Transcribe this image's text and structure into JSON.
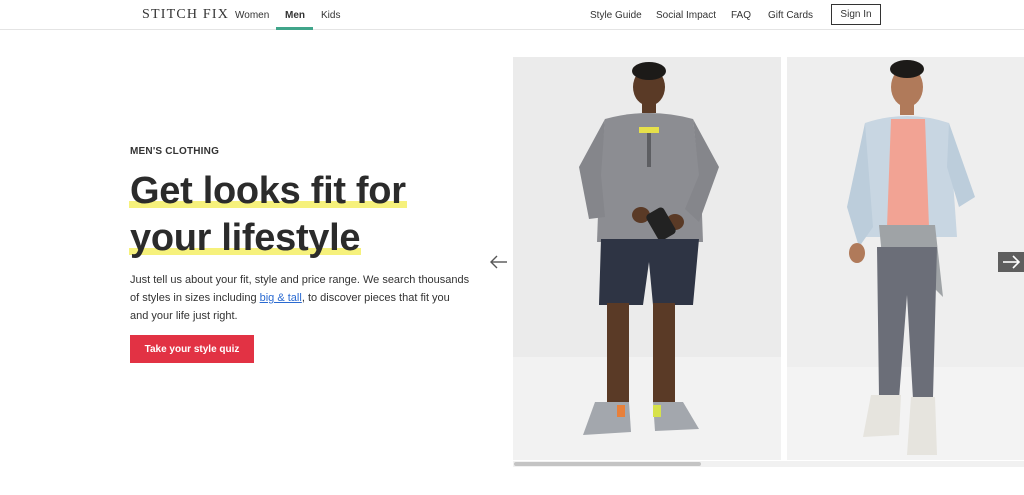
{
  "header": {
    "logo": "STITCH FIX",
    "nav_left": [
      "Women",
      "Men",
      "Kids"
    ],
    "active_index": 1,
    "nav_right": [
      "Style Guide",
      "Social Impact",
      "FAQ",
      "Gift Cards"
    ],
    "signin_label": "Sign In",
    "accent_color": "#40a58a"
  },
  "hero": {
    "eyebrow": "MEN'S CLOTHING",
    "headline_line1": "Get looks fit for",
    "headline_line2": "your lifestyle",
    "highlight_color": "#f6f17c",
    "body_before": "Just tell us about your fit, style and price range. We search thousands of styles in sizes including ",
    "body_link": "big & tall",
    "body_after": ", to discover pieces that fit you and your life just right.",
    "cta_label": "Take your style quiz",
    "cta_color": "#e23244"
  },
  "carousel": {
    "prev_icon": "arrow-left-icon",
    "next_icon": "arrow-right-icon",
    "slides": [
      {
        "subject": "man in grey hoodie and navy shorts"
      },
      {
        "subject": "man in plaid shirt and grey joggers"
      }
    ]
  }
}
